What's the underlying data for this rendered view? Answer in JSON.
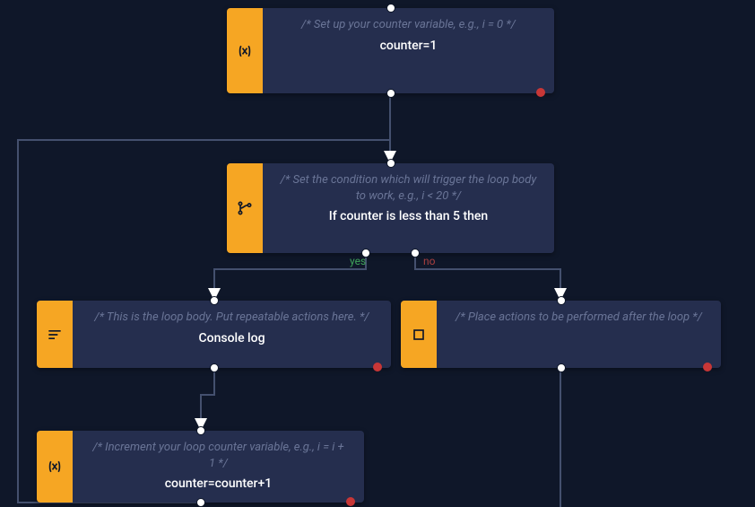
{
  "nodes": {
    "init": {
      "comment": "/* Set up your counter variable, e.g., i = 0 */",
      "title": "counter=1",
      "icon": "variable-icon"
    },
    "cond": {
      "comment": "/* Set the condition which will trigger the loop body to work, e.g., i < 20 */",
      "title": "If counter is less than 5 then",
      "icon": "branch-icon"
    },
    "body": {
      "comment": "/* This is the loop body. Put repeatable actions here. */",
      "title": "Console log",
      "icon": "text-lines-icon"
    },
    "after": {
      "comment": "/* Place actions to be performed after the loop */",
      "title": "",
      "icon": "square-icon"
    },
    "incr": {
      "comment": "/* Increment your loop counter variable, e.g., i = i + 1 */",
      "title": "counter=counter+1",
      "icon": "variable-icon"
    }
  },
  "branches": {
    "yes": "yes",
    "no": "no"
  },
  "colors": {
    "bg": "#0f1729",
    "node": "#252e4e",
    "accent": "#f6a623",
    "comment": "#6a7597",
    "wire": "#44506e",
    "yes": "#3fa35a",
    "no": "#a73f3f",
    "error": "#c83737"
  }
}
